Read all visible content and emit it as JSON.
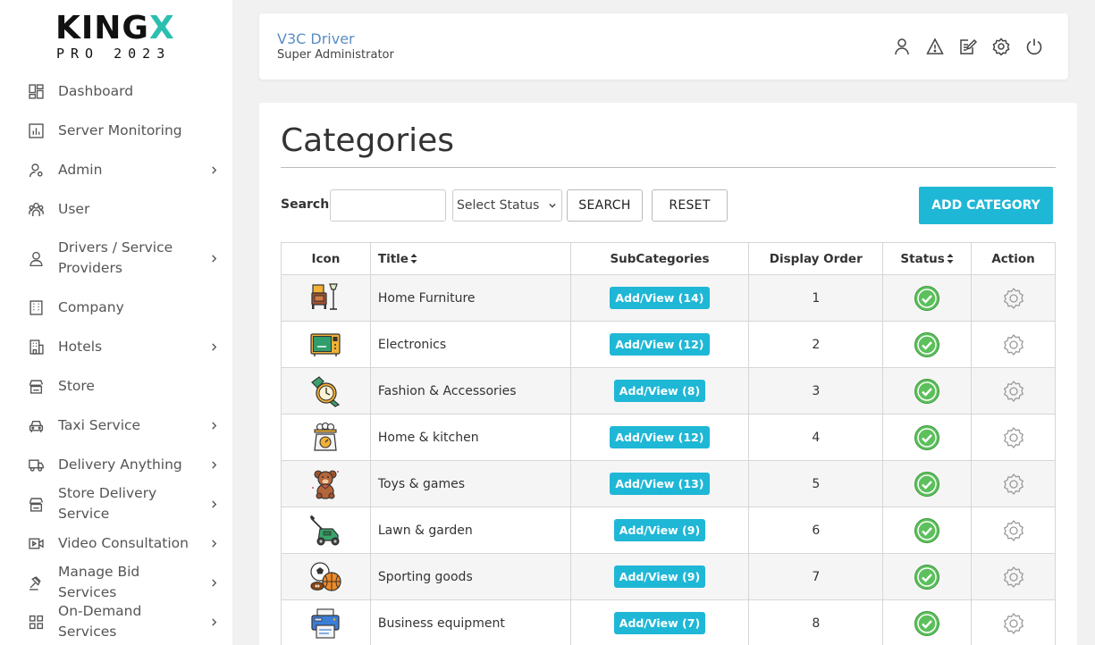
{
  "logo": {
    "main_a": "KING",
    "main_b": "X",
    "sub": "PRO 2023"
  },
  "sidebar": {
    "items": [
      {
        "label": "Dashboard",
        "icon": "dashboard-icon",
        "chevron": false
      },
      {
        "label": "Server Monitoring",
        "icon": "chart-icon",
        "chevron": false
      },
      {
        "label": "Admin",
        "icon": "admin-icon",
        "chevron": true
      },
      {
        "label": "User",
        "icon": "users-icon",
        "chevron": false
      },
      {
        "label": "Drivers / Service Providers",
        "icon": "driver-icon",
        "chevron": true
      },
      {
        "label": "Company",
        "icon": "building-icon",
        "chevron": false
      },
      {
        "label": "Hotels",
        "icon": "hotel-icon",
        "chevron": true
      },
      {
        "label": "Store",
        "icon": "store-icon",
        "chevron": false
      },
      {
        "label": "Taxi Service",
        "icon": "car-icon",
        "chevron": true
      },
      {
        "label": "Delivery Anything",
        "icon": "truck-icon",
        "chevron": true
      },
      {
        "label": "Store Delivery Service",
        "icon": "store-icon",
        "chevron": true
      },
      {
        "label": "Video Consultation",
        "icon": "video-icon",
        "chevron": true
      },
      {
        "label": "Manage Bid Services",
        "icon": "gavel-icon",
        "chevron": true
      },
      {
        "label": "On-Demand Services",
        "icon": "grid-icon",
        "chevron": true
      }
    ]
  },
  "header": {
    "name": "V3C Driver",
    "role": "Super Administrator",
    "icons": [
      "user-icon",
      "warning-icon",
      "edit-icon",
      "settings-icon",
      "power-icon"
    ]
  },
  "page": {
    "title": "Categories",
    "search_label": "Search:",
    "search_value": "",
    "status_select": "Select Status",
    "search_button": "SEARCH",
    "reset_button": "RESET",
    "add_button": "ADD CATEGORY"
  },
  "table": {
    "headers": {
      "icon": "Icon",
      "title": "Title",
      "subcategories": "SubCategories",
      "display_order": "Display Order",
      "status": "Status",
      "action": "Action"
    },
    "rows": [
      {
        "icon": "furniture-icon",
        "title": "Home Furniture",
        "sub": "Add/View (14)",
        "order": "1",
        "status": "active"
      },
      {
        "icon": "electronics-icon",
        "title": "Electronics",
        "sub": "Add/View (12)",
        "order": "2",
        "status": "active"
      },
      {
        "icon": "watch-icon",
        "title": "Fashion & Accessories",
        "sub": "Add/View (8)",
        "order": "3",
        "status": "active"
      },
      {
        "icon": "kitchen-scale-icon",
        "title": "Home & kitchen",
        "sub": "Add/View (12)",
        "order": "4",
        "status": "active"
      },
      {
        "icon": "teddy-bear-icon",
        "title": "Toys & games",
        "sub": "Add/View (13)",
        "order": "5",
        "status": "active"
      },
      {
        "icon": "lawn-mower-icon",
        "title": "Lawn & garden",
        "sub": "Add/View (9)",
        "order": "6",
        "status": "active"
      },
      {
        "icon": "sports-balls-icon",
        "title": "Sporting goods",
        "sub": "Add/View (9)",
        "order": "7",
        "status": "active"
      },
      {
        "icon": "printer-icon",
        "title": "Business equipment",
        "sub": "Add/View (7)",
        "order": "8",
        "status": "active"
      }
    ]
  },
  "colors": {
    "accent": "#1fb7d6",
    "logo_x": "#2bbfb0",
    "header_name": "#5b8ec4",
    "status_green": "#5cc05c"
  }
}
